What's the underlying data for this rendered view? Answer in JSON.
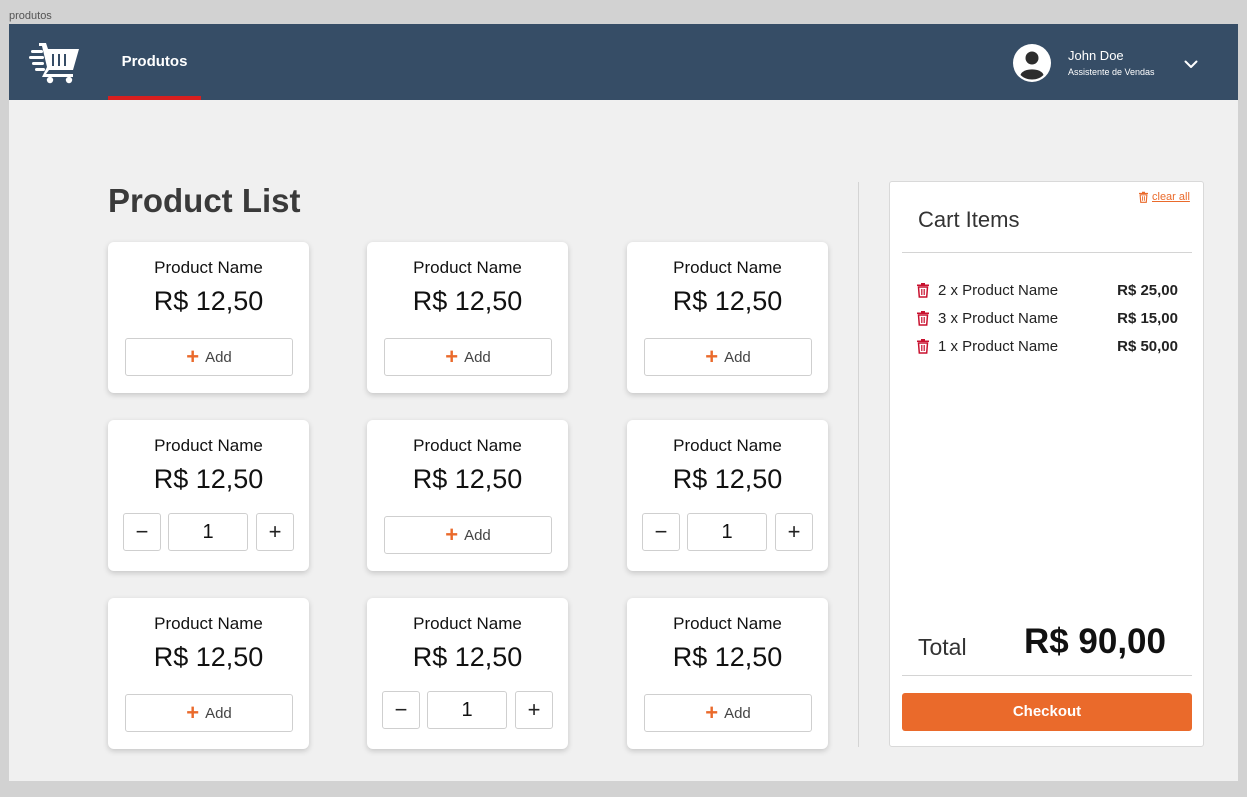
{
  "frame_label": "produtos",
  "nav": {
    "tab_label": "Produtos",
    "user_name": "John Doe",
    "user_role": "Assistente de Vendas"
  },
  "page_title": "Product List",
  "products": [
    {
      "name": "Product Name",
      "price": "R$ 12,50",
      "control": "add",
      "add_label": "Add"
    },
    {
      "name": "Product Name",
      "price": "R$ 12,50",
      "control": "add",
      "add_label": "Add"
    },
    {
      "name": "Product Name",
      "price": "R$ 12,50",
      "control": "add",
      "add_label": "Add"
    },
    {
      "name": "Product Name",
      "price": "R$ 12,50",
      "control": "stepper",
      "qty": "1"
    },
    {
      "name": "Product Name",
      "price": "R$ 12,50",
      "control": "add",
      "add_label": "Add"
    },
    {
      "name": "Product Name",
      "price": "R$ 12,50",
      "control": "stepper",
      "qty": "1"
    },
    {
      "name": "Product Name",
      "price": "R$ 12,50",
      "control": "add",
      "add_label": "Add"
    },
    {
      "name": "Product Name",
      "price": "R$ 12,50",
      "control": "stepper",
      "qty": "1"
    },
    {
      "name": "Product Name",
      "price": "R$ 12,50",
      "control": "add",
      "add_label": "Add"
    }
  ],
  "cart": {
    "title": "Cart Items",
    "clear_label": "clear all",
    "items": [
      {
        "desc": "2 x Product Name",
        "amount": "R$ 25,00"
      },
      {
        "desc": "3 x Product Name",
        "amount": "R$ 15,00"
      },
      {
        "desc": "1 x Product Name",
        "amount": "R$ 50,00"
      }
    ],
    "total_label": "Total",
    "total_value": "R$ 90,00",
    "checkout_label": "Checkout"
  },
  "colors": {
    "navbar": "#364d66",
    "accent": "#ea6a2b",
    "tab_underline": "#d81f1f",
    "trash": "#c8102e"
  },
  "icons": {
    "logo": "fast-cart-icon",
    "avatar": "user-avatar-icon",
    "chevron": "chevron-down-icon",
    "trash": "trash-icon",
    "plus": "plus-icon",
    "minus": "minus-icon"
  }
}
